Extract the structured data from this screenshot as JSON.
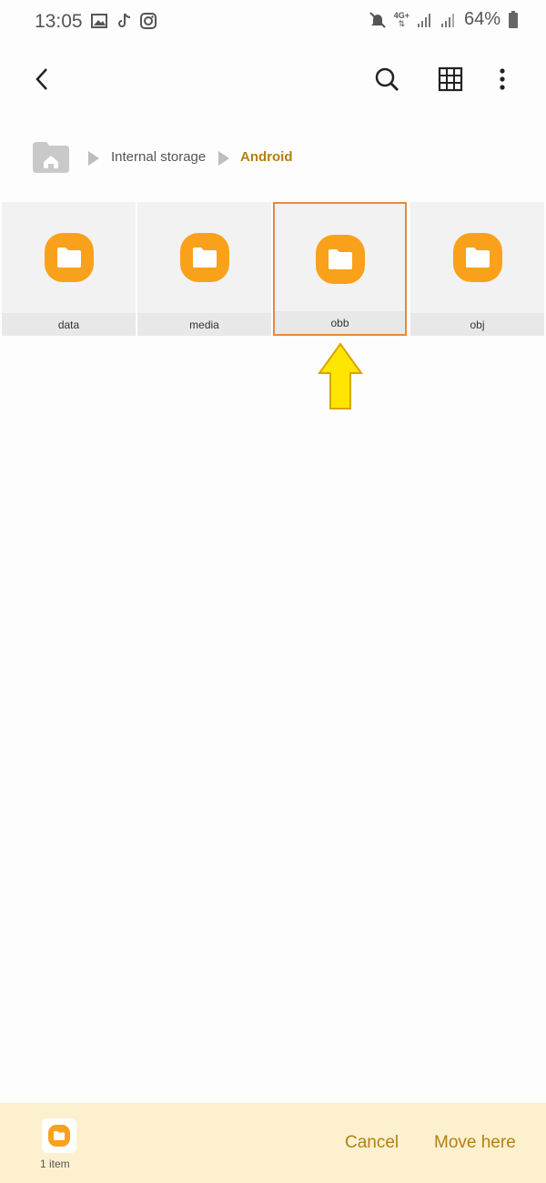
{
  "status": {
    "time": "13:05",
    "icons_left": [
      "image-icon",
      "tiktok-icon",
      "instagram-icon"
    ],
    "icons_right": [
      "mute-icon",
      "4g-icon",
      "signal-icon",
      "signal-icon-2",
      "battery-icon"
    ],
    "network_label": "4G+",
    "battery": "64%"
  },
  "toolbar": {
    "back_icon": "chevron-left-icon",
    "search_icon": "search-icon",
    "grid_icon": "grid-icon",
    "more_icon": "more-vertical-icon"
  },
  "breadcrumb": {
    "home_icon": "home-folder-icon",
    "items": [
      "Internal storage",
      "Android"
    ]
  },
  "folders": [
    {
      "name": "data",
      "selected": false
    },
    {
      "name": "media",
      "selected": false
    },
    {
      "name": "obb",
      "selected": true
    },
    {
      "name": "obj",
      "selected": false
    }
  ],
  "bottom": {
    "count": "1 item",
    "cancel": "Cancel",
    "move": "Move here"
  },
  "colors": {
    "accent": "#b4800f",
    "folder": "#f9a11b",
    "highlight": "#e58a3a",
    "arrow": "#ffe600"
  }
}
